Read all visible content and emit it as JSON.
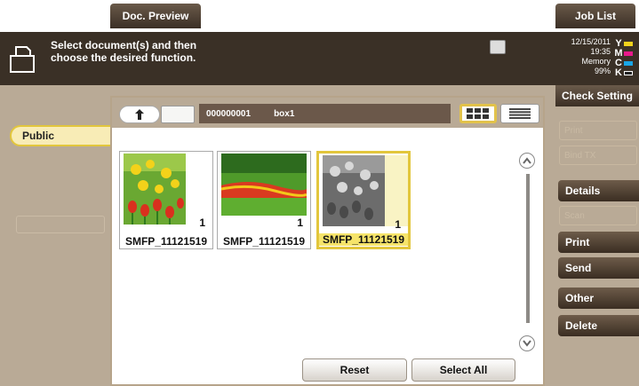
{
  "header": {
    "doc_preview_label": "Doc. Preview",
    "job_list_label": "Job List"
  },
  "message": {
    "line1": "Select document(s) and then",
    "line2": "choose the desired function."
  },
  "status": {
    "date": "12/15/2011",
    "time": "19:35",
    "memory_label": "Memory",
    "memory_value": "99%",
    "toner": [
      {
        "letter": "Y",
        "color": "#f2d21c"
      },
      {
        "letter": "M",
        "color": "#e8198b"
      },
      {
        "letter": "C",
        "color": "#1aa6e6"
      },
      {
        "letter": "K",
        "color": "#222222"
      }
    ]
  },
  "left": {
    "public_tab": "Public"
  },
  "toolbar": {
    "box_number": "000000001",
    "box_name": "box1"
  },
  "documents": [
    {
      "name": "SMFP_11121519",
      "pages": "1",
      "selected": false
    },
    {
      "name": "SMFP_11121519",
      "pages": "1",
      "selected": false
    },
    {
      "name": "SMFP_11121519",
      "pages": "1",
      "selected": true
    }
  ],
  "bottom": {
    "reset_label": "Reset",
    "select_all_label": "Select All"
  },
  "right": {
    "check_setting_label": "Check Setting",
    "ghost1": "Print",
    "ghost2": "Bind TX",
    "details_label": "Details",
    "ghost3": "Scan",
    "print_label": "Print",
    "send_label": "Send",
    "other_label": "Other",
    "delete_label": "Delete"
  },
  "colors": {
    "panel_bg": "#b9aa96",
    "dark_brown": "#3a3026",
    "accent_yellow": "#e2c63c"
  }
}
